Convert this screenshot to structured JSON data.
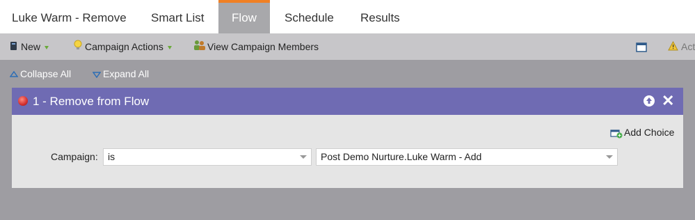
{
  "tabs": {
    "title": "Luke Warm - Remove",
    "items": [
      "Smart List",
      "Flow",
      "Schedule",
      "Results"
    ],
    "active": "Flow"
  },
  "toolbar": {
    "new_label": "New",
    "campaign_actions_label": "Campaign Actions",
    "view_members_label": "View Campaign Members",
    "activate_partial": "Act"
  },
  "subbar": {
    "collapse_label": "Collapse All",
    "expand_label": "Expand All"
  },
  "flow_step": {
    "title": "1 - Remove from Flow",
    "add_choice_label": "Add Choice",
    "field_label": "Campaign:",
    "operator_value": "is",
    "campaign_value": "Post Demo Nurture.Luke Warm - Add"
  },
  "colors": {
    "accent": "#f08024",
    "panel_header": "#6f6bb3",
    "active_tab": "#a8a8ab"
  }
}
